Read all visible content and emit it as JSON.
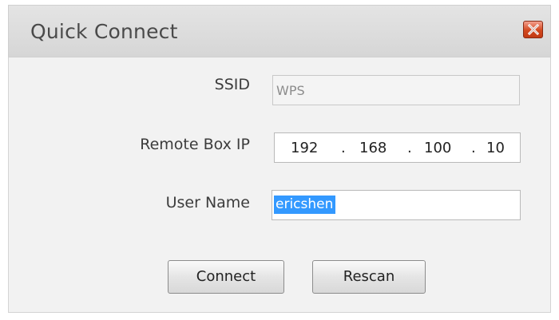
{
  "dialog": {
    "title": "Quick Connect",
    "close_icon": "close-x-icon"
  },
  "form": {
    "ssid": {
      "label": "SSID",
      "value": "WPS",
      "enabled": false
    },
    "remote_box_ip": {
      "label": "Remote Box IP",
      "octets": [
        "192",
        "168",
        "100",
        "10"
      ],
      "separator": "."
    },
    "user_name": {
      "label": "User Name",
      "value": "ericshen",
      "selected": true
    }
  },
  "buttons": {
    "connect": "Connect",
    "rescan": "Rescan"
  },
  "colors": {
    "selection": "#3399ff",
    "close_button": "#d2481f"
  }
}
